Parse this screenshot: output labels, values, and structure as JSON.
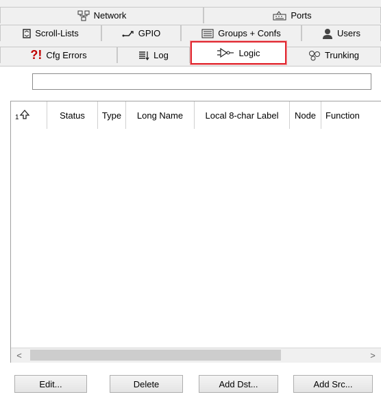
{
  "tabs": {
    "row1": [
      {
        "label": "Network",
        "icon": "network-icon"
      },
      {
        "label": "Ports",
        "icon": "ports-icon"
      }
    ],
    "row2": [
      {
        "label": "Scroll-Lists",
        "icon": "scroll-list-icon"
      },
      {
        "label": "GPIO",
        "icon": "gpio-icon"
      },
      {
        "label": "Groups + Confs",
        "icon": "groups-icon"
      },
      {
        "label": "Users",
        "icon": "users-icon"
      }
    ],
    "row3": [
      {
        "label": "Cfg Errors",
        "icon": "cfg-errors-icon",
        "prefix": "?!"
      },
      {
        "label": "Log",
        "icon": "log-icon"
      },
      {
        "label": "Logic",
        "icon": "logic-icon",
        "active": true
      },
      {
        "label": "Trunking",
        "icon": "trunking-icon"
      }
    ]
  },
  "search": {
    "value": "",
    "placeholder": ""
  },
  "table": {
    "sort_indicator": "1",
    "columns": [
      "Status",
      "Type",
      "Long Name",
      "Local 8-char Label",
      "Node",
      "Function"
    ],
    "rows": []
  },
  "scrollbar": {
    "left_arrow": "<",
    "right_arrow": ">"
  },
  "buttons": {
    "edit": "Edit...",
    "delete": "Delete",
    "add_dst": "Add Dst...",
    "add_src": "Add Src..."
  },
  "colors": {
    "active_tab_highlight": "#e0262f",
    "error_prefix": "#c00000"
  }
}
